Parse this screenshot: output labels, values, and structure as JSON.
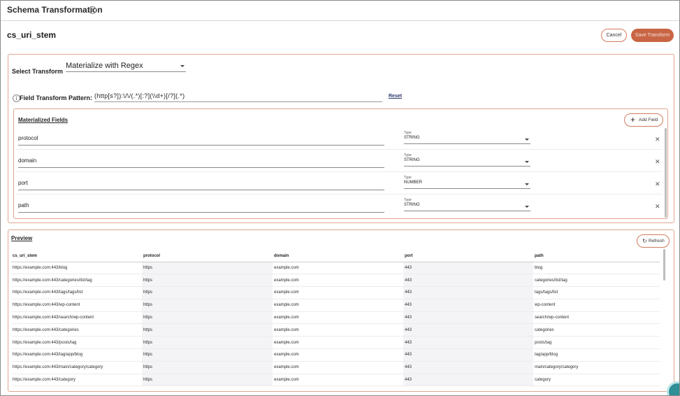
{
  "header": {
    "title": "Schema Transformation",
    "info_icon": "info-icon"
  },
  "field": {
    "name": "cs_uri_stem"
  },
  "actions": {
    "cancel_label": "Cancel",
    "save_label": "Save Transform"
  },
  "transform": {
    "select_label": "Select Transform",
    "selected": "Materialize with Regex",
    "pattern_label": "Field Transform Pattern:",
    "pattern_value": "(http[s?]):\\/\\/(.*)[:?](\\\\d+)[/?](.*)",
    "reset_label": "Reset"
  },
  "materialized": {
    "title": "Materialized Fields",
    "add_label": "Add Field",
    "type_label": "Type",
    "fields": [
      {
        "name": "protocol",
        "type": "STRING"
      },
      {
        "name": "domain",
        "type": "STRING"
      },
      {
        "name": "port",
        "type": "NUMBER"
      },
      {
        "name": "path",
        "type": "STRING"
      }
    ]
  },
  "preview": {
    "title": "Preview",
    "refresh_label": "Refresh",
    "columns": [
      "cs_uri_stem",
      "protocol",
      "domain",
      "port",
      "path"
    ],
    "rows": [
      [
        "https://example.com:443/blog",
        "https",
        "example.com",
        "443",
        "blog"
      ],
      [
        "https://example.com:443/categories/list/tag",
        "https",
        "example.com",
        "443",
        "categories/list/tag"
      ],
      [
        "https://example.com:443/tags/tags/list",
        "https",
        "example.com",
        "443",
        "tags/tags/list"
      ],
      [
        "https://example.com:443/wp-content",
        "https",
        "example.com",
        "443",
        "wp-content"
      ],
      [
        "https://example.com:443/search/wp-content",
        "https",
        "example.com",
        "443",
        "search/wp-content"
      ],
      [
        "https://example.com:443/categories",
        "https",
        "example.com",
        "443",
        "categories"
      ],
      [
        "https://example.com:443/posts/tag",
        "https",
        "example.com",
        "443",
        "posts/tag"
      ],
      [
        "https://example.com:443/tag/app/blog",
        "https",
        "example.com",
        "443",
        "tag/app/blog"
      ],
      [
        "https://example.com:443/main/category/category",
        "https",
        "example.com",
        "443",
        "main/category/category"
      ],
      [
        "https://example.com:443/category",
        "https",
        "example.com",
        "443",
        "category"
      ]
    ]
  },
  "colors": {
    "accent": "#c96544",
    "accent_border": "#e0a58f",
    "link": "#2e3a6a"
  }
}
